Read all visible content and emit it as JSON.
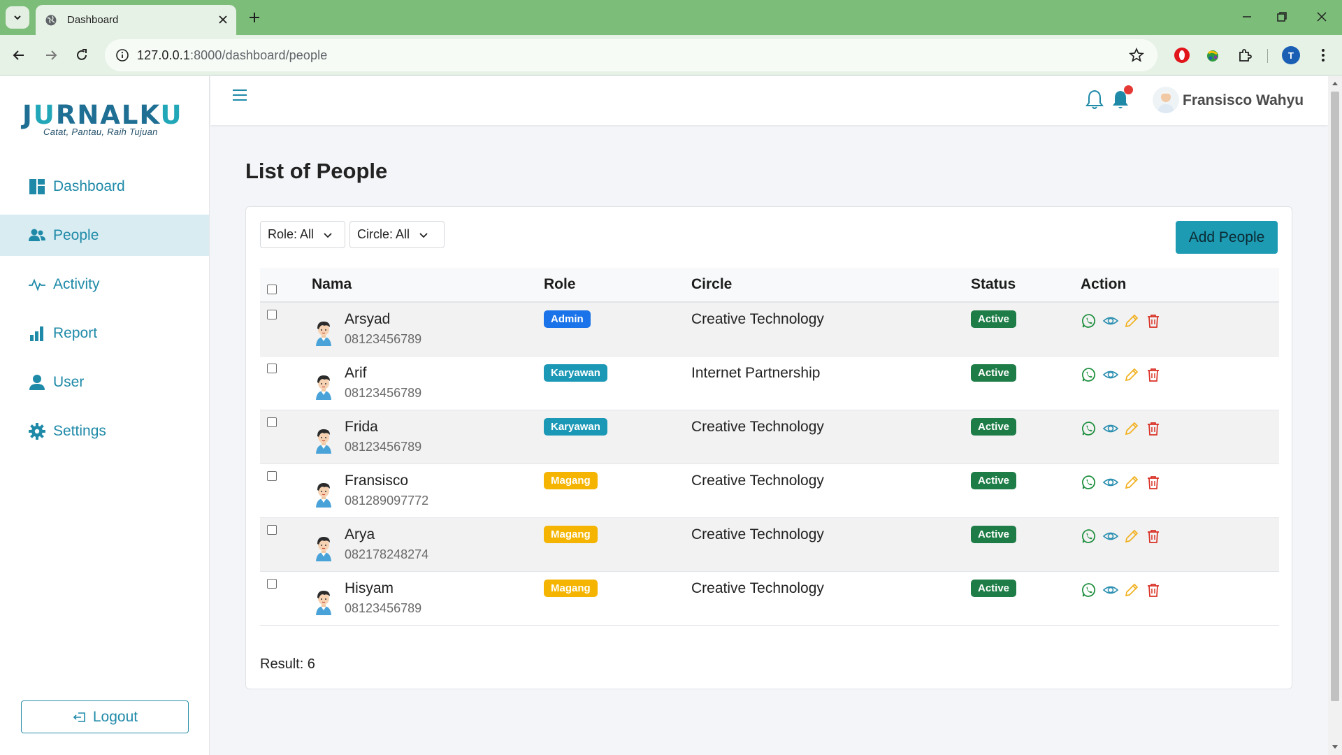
{
  "browser": {
    "tab_title": "Dashboard",
    "url_host": "127.0.0.1",
    "url_path": ":8000/dashboard/people",
    "profile_initial": "T"
  },
  "sidebar": {
    "logo_text_a": "J",
    "logo_text_u": "U",
    "logo_text_b": "RNALK",
    "logo_text_u2": "U",
    "logo_tagline": "Catat, Pantau, Raih Tujuan",
    "items": [
      {
        "label": "Dashboard",
        "icon": "dashboard-icon"
      },
      {
        "label": "People",
        "icon": "people-icon",
        "active": true
      },
      {
        "label": "Activity",
        "icon": "activity-icon"
      },
      {
        "label": "Report",
        "icon": "report-icon"
      },
      {
        "label": "User",
        "icon": "user-icon"
      },
      {
        "label": "Settings",
        "icon": "gear-icon"
      }
    ],
    "logout_label": "Logout"
  },
  "header": {
    "user_name": "Fransisco Wahyu"
  },
  "page": {
    "title": "List of People",
    "filters": {
      "role_label": "Role: All",
      "circle_label": "Circle: All"
    },
    "add_button": "Add People",
    "columns": [
      "Nama",
      "Role",
      "Circle",
      "Status",
      "Action"
    ],
    "rows": [
      {
        "name": "Arsyad",
        "phone": "08123456789",
        "role": "Admin",
        "role_color": "#1a73e8",
        "circle": "Creative Technology",
        "status": "Active"
      },
      {
        "name": "Arif",
        "phone": "08123456789",
        "role": "Karyawan",
        "role_color": "#1b98b6",
        "circle": "Internet Partnership",
        "status": "Active"
      },
      {
        "name": "Frida",
        "phone": "08123456789",
        "role": "Karyawan",
        "role_color": "#1b98b6",
        "circle": "Creative Technology",
        "status": "Active"
      },
      {
        "name": "Fransisco",
        "phone": "081289097772",
        "role": "Magang",
        "role_color": "#f4b400",
        "circle": "Creative Technology",
        "status": "Active"
      },
      {
        "name": "Arya",
        "phone": "082178248274",
        "role": "Magang",
        "role_color": "#f4b400",
        "circle": "Creative Technology",
        "status": "Active"
      },
      {
        "name": "Hisyam",
        "phone": "08123456789",
        "role": "Magang",
        "role_color": "#f4b400",
        "circle": "Creative Technology",
        "status": "Active"
      }
    ],
    "result_label": "Result: 6"
  },
  "colors": {
    "accent": "#1f8aa8",
    "status_active": "#1e7d47",
    "whatsapp": "#1e8e3e",
    "view": "#2a8fb0",
    "edit": "#f2b01e",
    "delete": "#d93025"
  }
}
